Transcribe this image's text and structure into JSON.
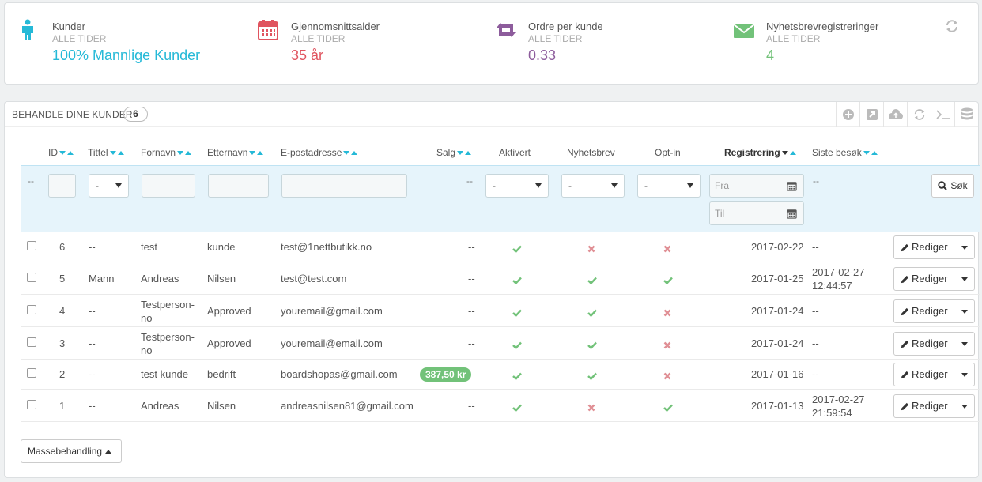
{
  "kpis": [
    {
      "title": "Kunder",
      "sub": "ALLE TIDER",
      "value": "100% Mannlige Kunder",
      "color": "#25b9d7",
      "icon": "male-icon"
    },
    {
      "title": "Gjennomsnittsalder",
      "sub": "ALLE TIDER",
      "value": "35 år",
      "color": "#e08f95",
      "icon": "calendar-icon"
    },
    {
      "title": "Ordre per kunde",
      "sub": "ALLE TIDER",
      "value": "0.33",
      "color": "#ab7fb7",
      "icon": "retweet-icon"
    },
    {
      "title": "Nyhetsbrevregistreringer",
      "sub": "ALLE TIDER",
      "value": "4",
      "color": "#72c279",
      "icon": "envelope-icon"
    }
  ],
  "list": {
    "title": "BEHANDLE DINE KUNDER",
    "count": "6",
    "columns": {
      "id": "ID",
      "title": "Tittel",
      "firstname": "Fornavn",
      "lastname": "Etternavn",
      "email": "E-postadresse",
      "sales": "Salg",
      "active": "Aktivert",
      "newsletter": "Nyhetsbrev",
      "optin": "Opt-in",
      "registration": "Registrering",
      "last_visit": "Siste besøk"
    },
    "filters": {
      "dash": "--",
      "select_default": "-",
      "date_from": "Fra",
      "date_to": "Til",
      "search_label": "Søk"
    },
    "rows": [
      {
        "id": "6",
        "title": "--",
        "firstname": "test",
        "firstname2": "",
        "lastname": "kunde",
        "email": "test@1nettbutikk.no",
        "sales": "--",
        "active": true,
        "newsletter": false,
        "optin": false,
        "registration": "2017-02-22",
        "last_visit": "--",
        "last_visit2": "",
        "edit": "Rediger"
      },
      {
        "id": "5",
        "title": "Mann",
        "firstname": "Andreas",
        "firstname2": "",
        "lastname": "Nilsen",
        "email": "test@test.com",
        "sales": "--",
        "active": true,
        "newsletter": true,
        "optin": true,
        "registration": "2017-01-25",
        "last_visit": "2017-02-27",
        "last_visit2": "12:44:57",
        "edit": "Rediger"
      },
      {
        "id": "4",
        "title": "--",
        "firstname": "Testperson-",
        "firstname2": "no",
        "lastname": "Approved",
        "email": "youremail@gmail.com",
        "sales": "--",
        "active": true,
        "newsletter": true,
        "optin": false,
        "registration": "2017-01-24",
        "last_visit": "--",
        "last_visit2": "",
        "edit": "Rediger"
      },
      {
        "id": "3",
        "title": "--",
        "firstname": "Testperson-",
        "firstname2": "no",
        "lastname": "Approved",
        "email": "youremail@email.com",
        "sales": "--",
        "active": true,
        "newsletter": true,
        "optin": false,
        "registration": "2017-01-24",
        "last_visit": "--",
        "last_visit2": "",
        "edit": "Rediger"
      },
      {
        "id": "2",
        "title": "--",
        "firstname": "test kunde",
        "firstname2": "",
        "lastname": "bedrift",
        "email": "boardshopas@gmail.com",
        "sales": "387,50 kr",
        "active": true,
        "newsletter": true,
        "optin": false,
        "registration": "2017-01-16",
        "last_visit": "--",
        "last_visit2": "",
        "edit": "Rediger"
      },
      {
        "id": "1",
        "title": "--",
        "firstname": "Andreas",
        "firstname2": "",
        "lastname": "Nilsen",
        "email": "andreasnilsen81@gmail.com",
        "sales": "--",
        "active": true,
        "newsletter": false,
        "optin": true,
        "registration": "2017-01-13",
        "last_visit": "2017-02-27",
        "last_visit2": "21:59:54",
        "edit": "Rediger"
      }
    ],
    "bulk_label": "Massebehandling"
  },
  "colors": {
    "check": "#72c279",
    "cross": "#e08f95",
    "sort": "#25b9d7",
    "filter_bg": "#e6f4fb"
  }
}
